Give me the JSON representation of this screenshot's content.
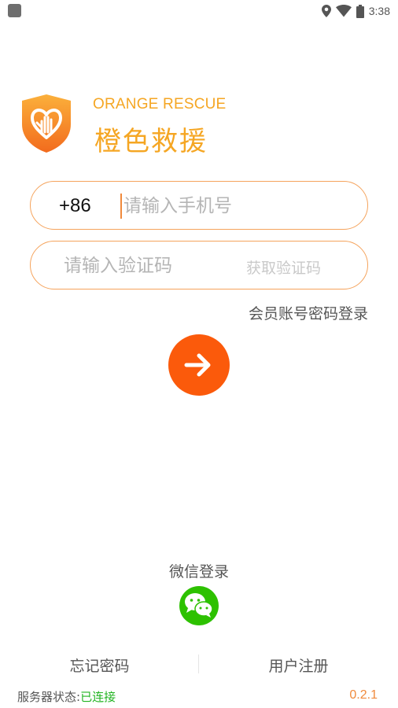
{
  "status_bar": {
    "time": "3:38",
    "icons": [
      "app-notification-icon",
      "location-icon",
      "wifi-icon",
      "battery-icon"
    ]
  },
  "logo": {
    "icon": "heart-hand-shield-icon",
    "en": "ORANGE RESCUE",
    "cn": "橙色救援"
  },
  "phone": {
    "country_code": "+86",
    "placeholder": "请输入手机号",
    "value": ""
  },
  "code": {
    "placeholder": "请输入验证码",
    "value": "",
    "get_code": "获取验证码"
  },
  "member_login": "会员账号密码登录",
  "submit": {
    "icon": "arrow-right-icon"
  },
  "wechat": {
    "label": "微信登录",
    "icon": "wechat-icon"
  },
  "links": {
    "forgot": "忘记密码",
    "register": "用户注册"
  },
  "server": {
    "label": "服务器状态:",
    "value": "已连接"
  },
  "version": "0.2.1",
  "colors": {
    "accent": "#f5a623",
    "field_border": "#f5a35c",
    "submit": "#fb5a0b",
    "wechat": "#2dc100",
    "connected": "#22b422"
  }
}
